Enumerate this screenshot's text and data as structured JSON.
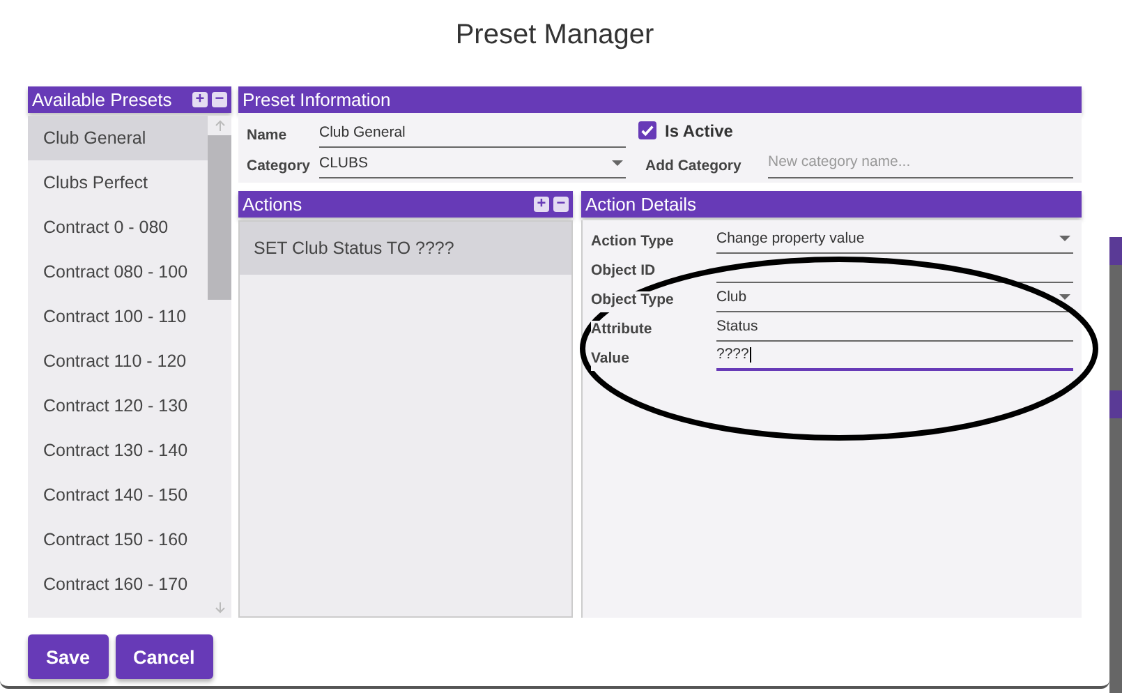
{
  "dialog": {
    "title": "Preset Manager"
  },
  "presets": {
    "title": "Available Presets",
    "add": "+",
    "remove": "−",
    "items": [
      {
        "label": "Club General",
        "selected": true
      },
      {
        "label": "Clubs Perfect",
        "selected": false
      },
      {
        "label": "Contract 0 - 080",
        "selected": false
      },
      {
        "label": "Contract 080 - 100",
        "selected": false
      },
      {
        "label": "Contract 100  - 110",
        "selected": false
      },
      {
        "label": "Contract 110  - 120",
        "selected": false
      },
      {
        "label": "Contract 120  - 130",
        "selected": false
      },
      {
        "label": "Contract 130  - 140",
        "selected": false
      },
      {
        "label": "Contract 140  - 150",
        "selected": false
      },
      {
        "label": "Contract 150  - 160",
        "selected": false
      },
      {
        "label": "Contract 160  - 170",
        "selected": false
      }
    ]
  },
  "preset_information": {
    "title": "Preset Information",
    "name_label": "Name",
    "name": "Club General",
    "category_label": "Category",
    "category": "CLUBS",
    "is_active_label": "Is Active",
    "is_active": true,
    "add_category_label": "Add Category",
    "add_category_placeholder": "New category name..."
  },
  "actions": {
    "title": "Actions",
    "add": "+",
    "remove": "−",
    "items": [
      {
        "label": "SET Club Status TO ????",
        "selected": true
      }
    ]
  },
  "action_details": {
    "title": "Action Details",
    "fields": [
      {
        "label": "Action Type",
        "value": "Change property value",
        "kind": "dropdown",
        "focused": false
      },
      {
        "label": "Object ID",
        "kind": "text",
        "focused": false
      },
      {
        "label": "Object Type",
        "value": "Club",
        "kind": "dropdown",
        "focused": false
      },
      {
        "label": "Attribute",
        "value": "Status",
        "kind": "text",
        "focused": false
      },
      {
        "label": "Value",
        "value": "????",
        "kind": "text",
        "focused": true
      }
    ]
  },
  "buttons": [
    {
      "label": "Save"
    },
    {
      "label": "Cancel"
    }
  ]
}
